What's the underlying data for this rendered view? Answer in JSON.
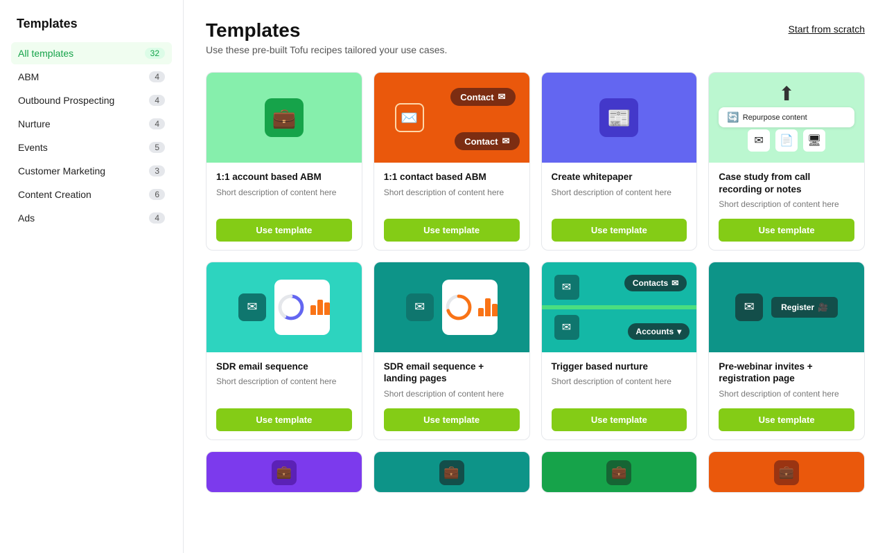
{
  "sidebar": {
    "title": "Templates",
    "items": [
      {
        "id": "all",
        "label": "All templates",
        "count": 32,
        "active": true
      },
      {
        "id": "abm",
        "label": "ABM",
        "count": 4,
        "active": false
      },
      {
        "id": "outbound",
        "label": "Outbound Prospecting",
        "count": 4,
        "active": false
      },
      {
        "id": "nurture",
        "label": "Nurture",
        "count": 4,
        "active": false
      },
      {
        "id": "events",
        "label": "Events",
        "count": 5,
        "active": false
      },
      {
        "id": "customer-marketing",
        "label": "Customer Marketing",
        "count": 3,
        "active": false
      },
      {
        "id": "content-creation",
        "label": "Content Creation",
        "count": 6,
        "active": false
      },
      {
        "id": "ads",
        "label": "Ads",
        "count": 4,
        "active": false
      }
    ]
  },
  "main": {
    "title": "Templates",
    "subtitle": "Use these pre-built Tofu recipes tailored your use cases.",
    "start_from_scratch": "Start from scratch",
    "use_template_label": "Use template",
    "cards": [
      {
        "id": "abm1",
        "title": "1:1 account based ABM",
        "desc": "Short description of content here"
      },
      {
        "id": "abm2",
        "title": "1:1 contact based ABM",
        "desc": "Short description of content here"
      },
      {
        "id": "whitepaper",
        "title": "Create whitepaper",
        "desc": "Short description of content here"
      },
      {
        "id": "casestudy",
        "title": "Case study from call recording or notes",
        "desc": "Short description of content here"
      },
      {
        "id": "sdr1",
        "title": "SDR email sequence",
        "desc": "Short description of content here"
      },
      {
        "id": "sdr2",
        "title": "SDR email sequence + landing pages",
        "desc": "Short description of content here"
      },
      {
        "id": "trigger",
        "title": "Trigger based nurture",
        "desc": "Short description of content here"
      },
      {
        "id": "webinar",
        "title": "Pre-webinar invites + registration page",
        "desc": "Short description of content here"
      }
    ]
  }
}
